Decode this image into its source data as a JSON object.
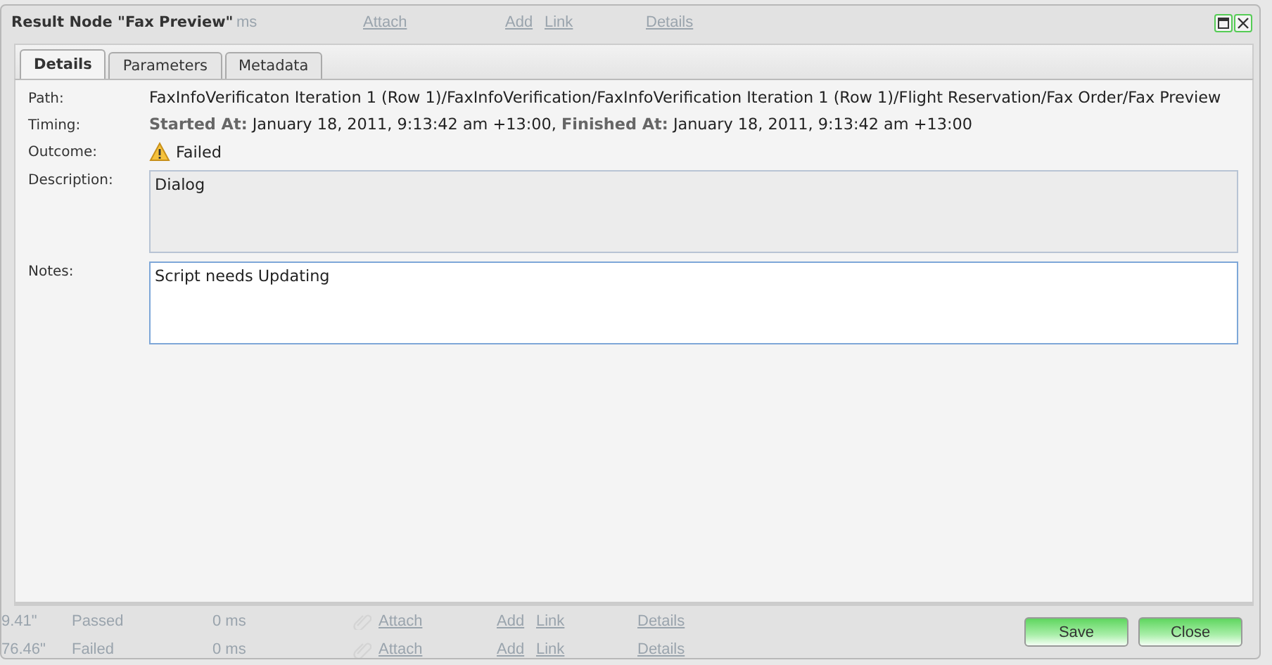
{
  "window": {
    "title": "Result Node \"Fax Preview\""
  },
  "window_controls": [
    {
      "kind": "maximize"
    },
    {
      "kind": "close"
    }
  ],
  "background_top_row": {
    "duration": "ms",
    "attach": "Attach",
    "add": "Add",
    "link": "Link",
    "details": "Details"
  },
  "tabs": [
    {
      "label": "Details",
      "selected": true
    },
    {
      "label": "Parameters",
      "selected": false
    },
    {
      "label": "Metadata",
      "selected": false
    }
  ],
  "path": {
    "label": "Path:",
    "value": "FaxInfoVerificaton Iteration 1 (Row 1)/FaxInfoVerification/FaxInfoVerification Iteration 1 (Row 1)/Flight Reservation/Fax Order/Fax Preview"
  },
  "timing": {
    "label": "Timing:",
    "started_label": "Started At:",
    "started_value": "January 18, 2011, 9:13:42 am +13:00,",
    "finished_label": "Finished At:",
    "finished_value": "January 18, 2011, 9:13:42 am +13:00"
  },
  "outcome": {
    "label": "Outcome:",
    "value": "Failed"
  },
  "description": {
    "label": "Description:",
    "value": "Dialog"
  },
  "notes": {
    "label": "Notes:",
    "value": "Script needs Updating"
  },
  "background_rows": [
    {
      "column_1": "9.41\"",
      "status": "Passed",
      "duration": "0 ms",
      "attach": "Attach",
      "add": "Add",
      "link": "Link",
      "details": "Details"
    },
    {
      "column_1": "76.46\"",
      "status": "Failed",
      "duration": "0 ms",
      "attach": "Attach",
      "add": "Add",
      "link": "Link",
      "details": "Details"
    }
  ],
  "buttons": [
    "Save",
    "Close"
  ]
}
